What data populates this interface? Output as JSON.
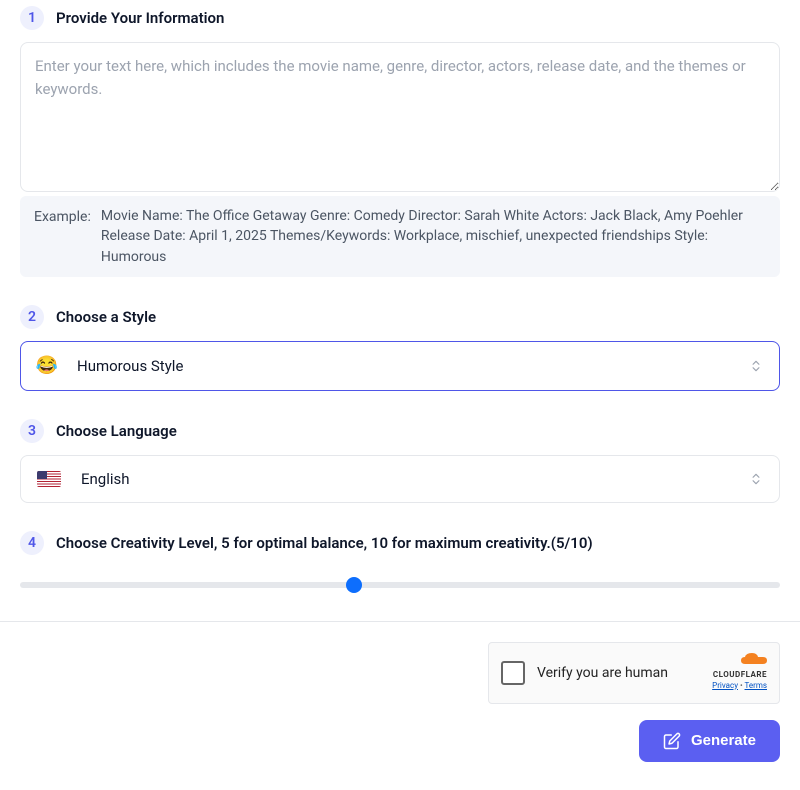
{
  "steps": {
    "info": {
      "number": "1",
      "title": "Provide Your Information",
      "placeholder": "Enter your text here, which includes the movie name, genre, director, actors, release date, and the themes or keywords.",
      "value": "",
      "example_label": "Example:",
      "example_text": "Movie Name: The Office Getaway Genre: Comedy Director: Sarah White Actors: Jack Black, Amy Poehler Release Date: April 1, 2025 Themes/Keywords: Workplace, mischief, unexpected friendships Style: Humorous"
    },
    "style": {
      "number": "2",
      "title": "Choose a Style",
      "emoji": "😂",
      "selected": "Humorous Style"
    },
    "language": {
      "number": "3",
      "title": "Choose Language",
      "selected": "English",
      "flag": "us"
    },
    "creativity": {
      "number": "4",
      "title": "Choose Creativity Level, 5 for optimal balance, 10 for maximum creativity.(5/10)",
      "value": 5,
      "min": 1,
      "max": 10,
      "percent": 44
    }
  },
  "captcha": {
    "text": "Verify you are human",
    "brand": "CLOUDFLARE",
    "privacy": "Privacy",
    "terms": "Terms"
  },
  "generate": {
    "label": "Generate"
  }
}
